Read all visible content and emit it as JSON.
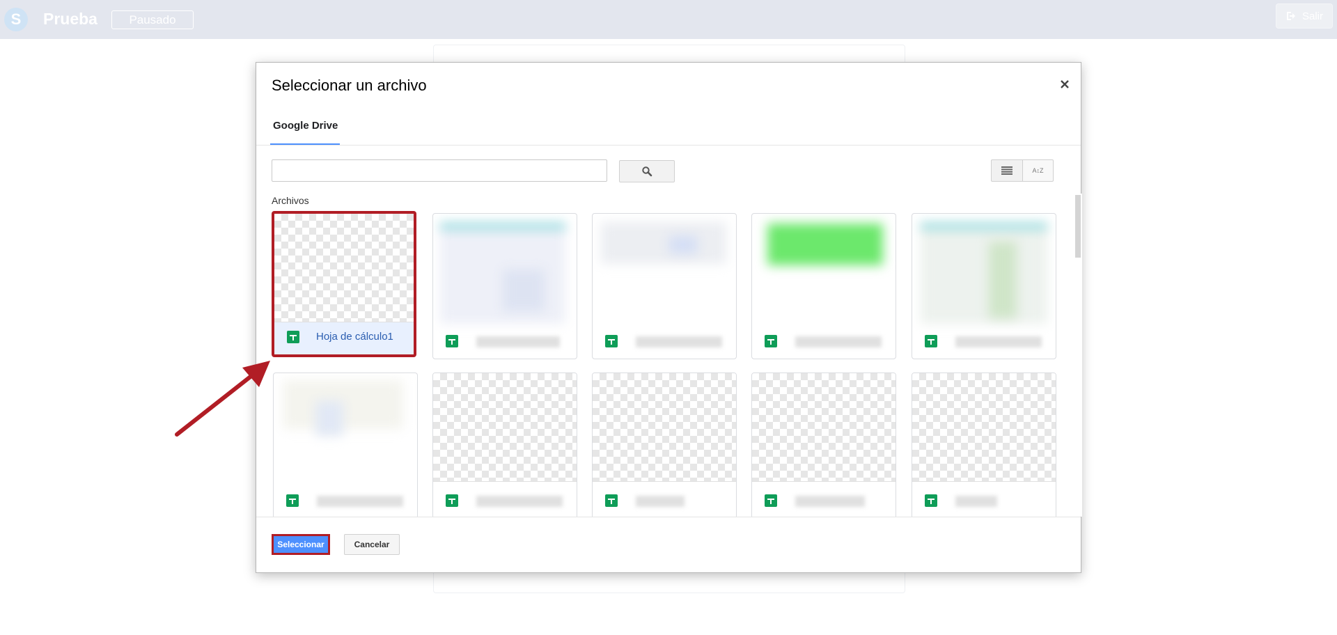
{
  "app": {
    "logo_letter": "S",
    "title": "Prueba",
    "status": "Pausado",
    "exit_label": "Salir"
  },
  "dialog": {
    "title": "Seleccionar un archivo",
    "close_glyph": "×",
    "tab_label": "Google Drive",
    "search": {
      "value": "",
      "placeholder": ""
    },
    "section_label": "Archivos",
    "files": [
      {
        "name": "Hoja de cálculo1",
        "selected": true
      },
      {
        "name": "",
        "selected": false
      },
      {
        "name": "",
        "selected": false
      },
      {
        "name": "",
        "selected": false
      },
      {
        "name": "",
        "selected": false
      },
      {
        "name": "",
        "selected": false
      },
      {
        "name": "",
        "selected": false
      },
      {
        "name": "",
        "selected": false
      },
      {
        "name": "",
        "selected": false
      },
      {
        "name": "",
        "selected": false
      }
    ],
    "select_label": "Seleccionar",
    "cancel_label": "Cancelar",
    "sort_glyph": "A↕Z"
  },
  "icons": {
    "logo": "app-logo-icon",
    "exit": "sign-out-icon",
    "close": "close-icon",
    "search": "search-icon",
    "list_view": "list-view-icon",
    "sort": "sort-az-icon",
    "file_type": "google-sheets-icon",
    "annotation": "red-arrow-icon"
  },
  "colors": {
    "accent": "#4d90fe",
    "highlight": "#b11d25",
    "sheets": "#0f9d58",
    "topbar": "#e3e6ee"
  }
}
